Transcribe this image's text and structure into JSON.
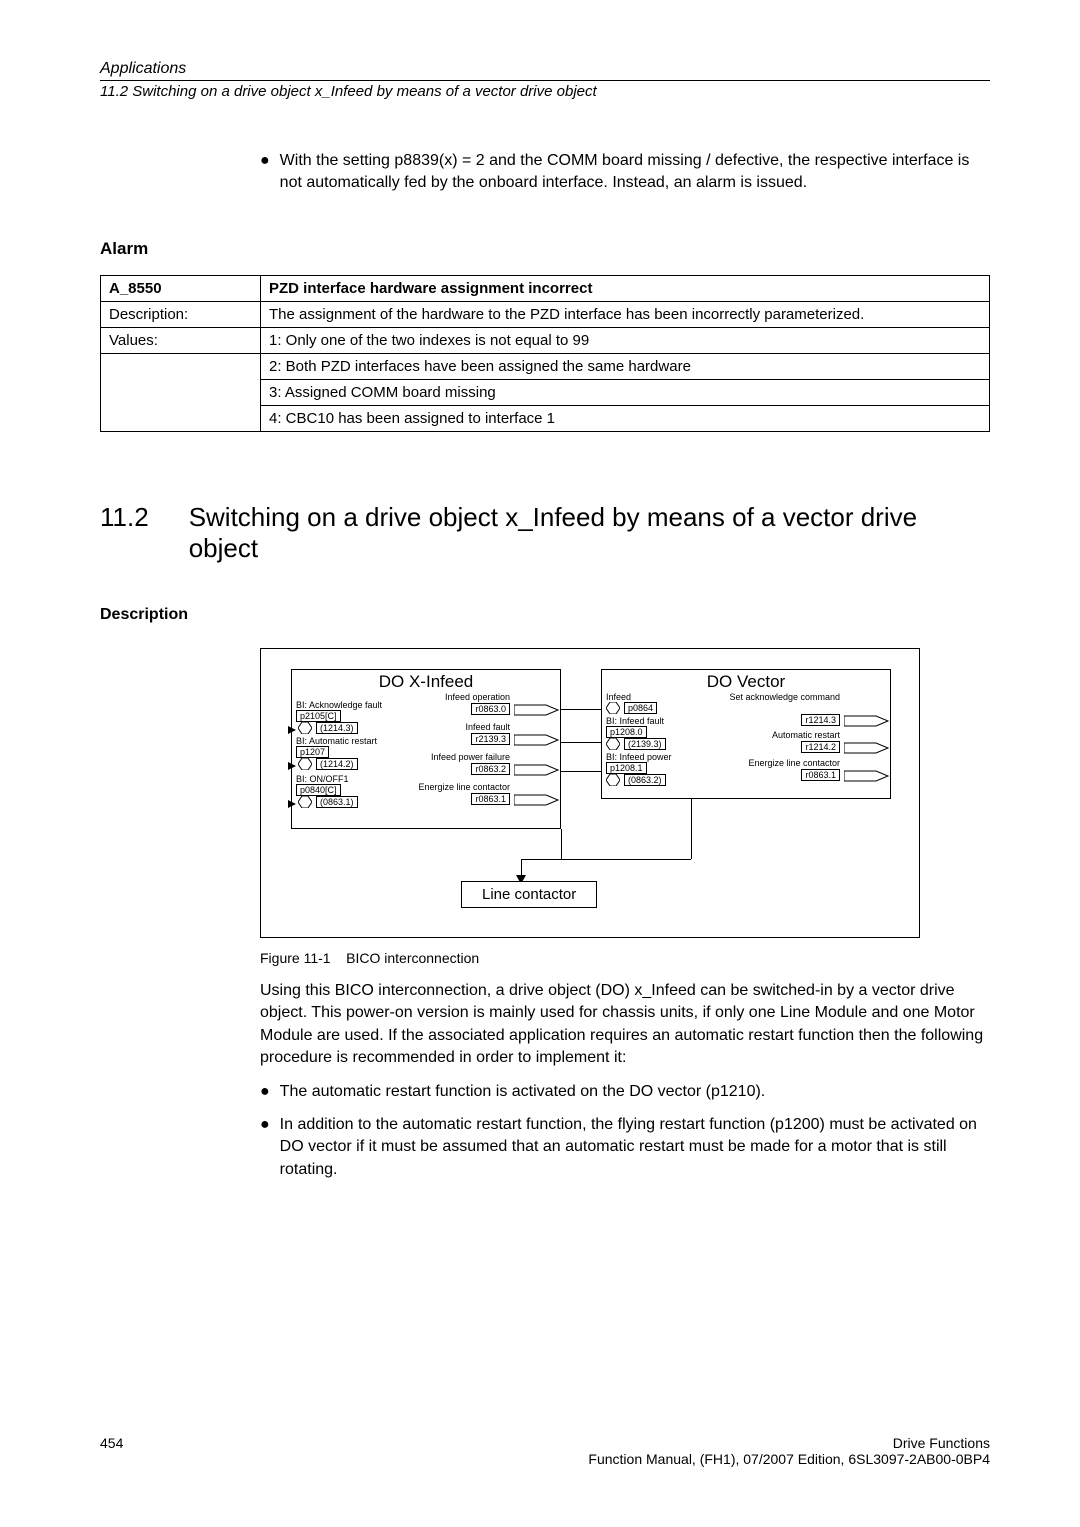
{
  "header": {
    "line1": "Applications",
    "line2": "11.2 Switching on a drive object x_Infeed by means of a vector drive object"
  },
  "top_bullet": "With the setting p8839(x) = 2 and the COMM board missing / defective, the respective interface is not automatically fed by the onboard interface. Instead, an alarm is issued.",
  "alarm_heading": "Alarm",
  "alarm_table": {
    "r1c1": "A_8550",
    "r1c2": "PZD interface hardware assignment incorrect",
    "r2c1": "Description:",
    "r2c2": "The assignment of the hardware to the PZD interface has been incorrectly parameterized.",
    "r3c1": "Values:",
    "r3c2": "1: Only one of the two indexes is not equal to 99",
    "r4c2": "2: Both PZD interfaces have been assigned the same hardware",
    "r5c2": "3: Assigned COMM board missing",
    "r6c2": "4: CBC10 has been assigned to interface 1"
  },
  "section": {
    "num": "11.2",
    "title": "Switching on a drive object x_Infeed by means of a vector drive object"
  },
  "description_heading": "Description",
  "figure": {
    "left_title": "DO X-Infeed",
    "right_title": "DO Vector",
    "left_rows": {
      "r1_bi": "BI: Acknowledge fault",
      "r1_p": "p2105[C]",
      "r1_v": "(1214.3)",
      "r2_bi": "BI: Automatic restart",
      "r2_p": "p1207",
      "r2_v": "(1214.2)",
      "r3_bi": "BI: ON/OFF1",
      "r3_p": "p0840[C]",
      "r3_v": "(0863.1)"
    },
    "left_right_col": {
      "l1": "Infeed operation",
      "l1b": "r0863.0",
      "l2": "Infeed fault",
      "l2b": "r2139.3",
      "l3": "Infeed power failure",
      "l3b": "r0863.2",
      "l4": "Energize line contactor",
      "l4b": "r0863.1"
    },
    "right_left_col": {
      "r1": "Infeed",
      "r1p": "p0864",
      "r2": "BI: Infeed fault",
      "r2p": "p1208.0",
      "r2v": "(2139.3)",
      "r3": "BI: Infeed power",
      "r3p": "p1208.1",
      "r3v": "(0863.2)"
    },
    "right_right_col": {
      "o1": "Set acknowledge command",
      "o1b": "r1214.3",
      "o2": "Automatic restart",
      "o2b": "r1214.2",
      "o3": "Energize line contactor",
      "o3b": "r0863.1"
    },
    "contactor": "Line contactor",
    "caption_label": "Figure 11-1",
    "caption_text": "BICO interconnection"
  },
  "para1": "Using this BICO interconnection, a drive object (DO) x_Infeed can be switched-in by a vector drive object. This power-on version is mainly used for chassis units, if only one Line Module and one Motor Module are used. If the associated application requires an automatic restart function then the following procedure is recommended in order to implement it:",
  "bul1": "The automatic restart function is activated on the DO vector (p1210).",
  "bul2": "In addition to the automatic restart function, the flying restart function (p1200) must be activated on DO vector if it must be assumed that an automatic restart must be made for a motor that is still rotating.",
  "footer": {
    "page": "454",
    "r1": "Drive Functions",
    "r2": "Function Manual, (FH1), 07/2007 Edition, 6SL3097-2AB00-0BP4"
  }
}
